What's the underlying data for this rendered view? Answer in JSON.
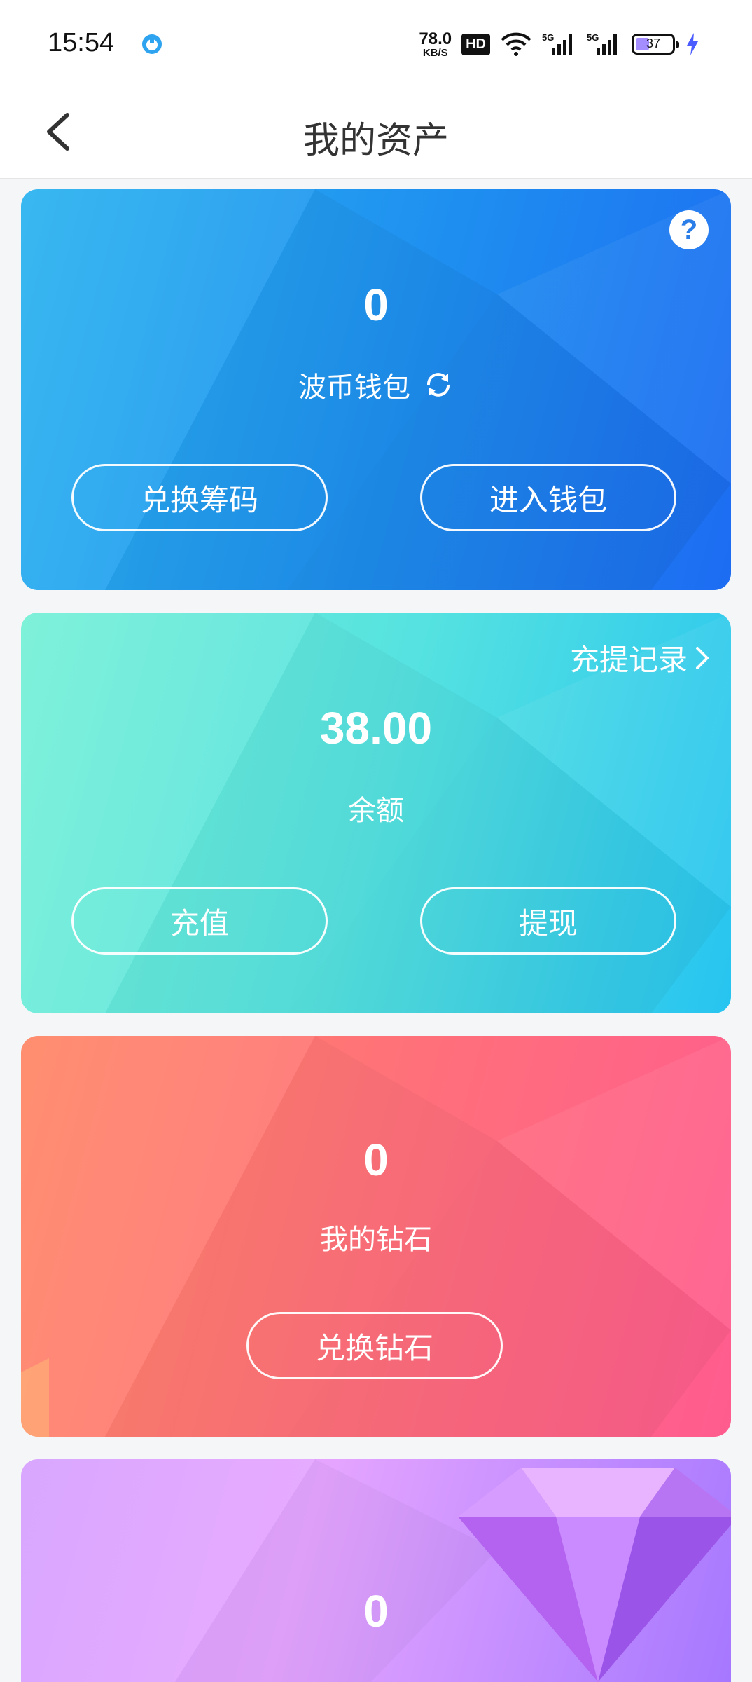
{
  "status_bar": {
    "time": "15:54",
    "net_speed_value": "78.0",
    "net_speed_unit": "KB/S",
    "hd_label": "HD",
    "battery_level": "37",
    "battery_fraction": 0.37
  },
  "header": {
    "title": "我的资产"
  },
  "cards": {
    "wallet": {
      "value": "0",
      "label": "波币钱包",
      "btn_exchange": "兑换筹码",
      "btn_enter": "进入钱包"
    },
    "balance": {
      "value": "38.00",
      "label": "余额",
      "record_link": "充提记录",
      "btn_recharge": "充值",
      "btn_withdraw": "提现"
    },
    "diamond": {
      "value": "0",
      "label": "我的钻石",
      "btn_exchange": "兑换钻石"
    },
    "gem": {
      "value": "0"
    }
  },
  "colors": {
    "wallet_gradient": [
      "#2cb2f0",
      "#1f6df2"
    ],
    "balance_gradient": [
      "#72f0d4",
      "#27c3f0"
    ],
    "diamond_gradient": [
      "#ff8464",
      "#ff5c8e"
    ],
    "gem_gradient": [
      "#e9a3ff",
      "#9a6bff"
    ]
  }
}
